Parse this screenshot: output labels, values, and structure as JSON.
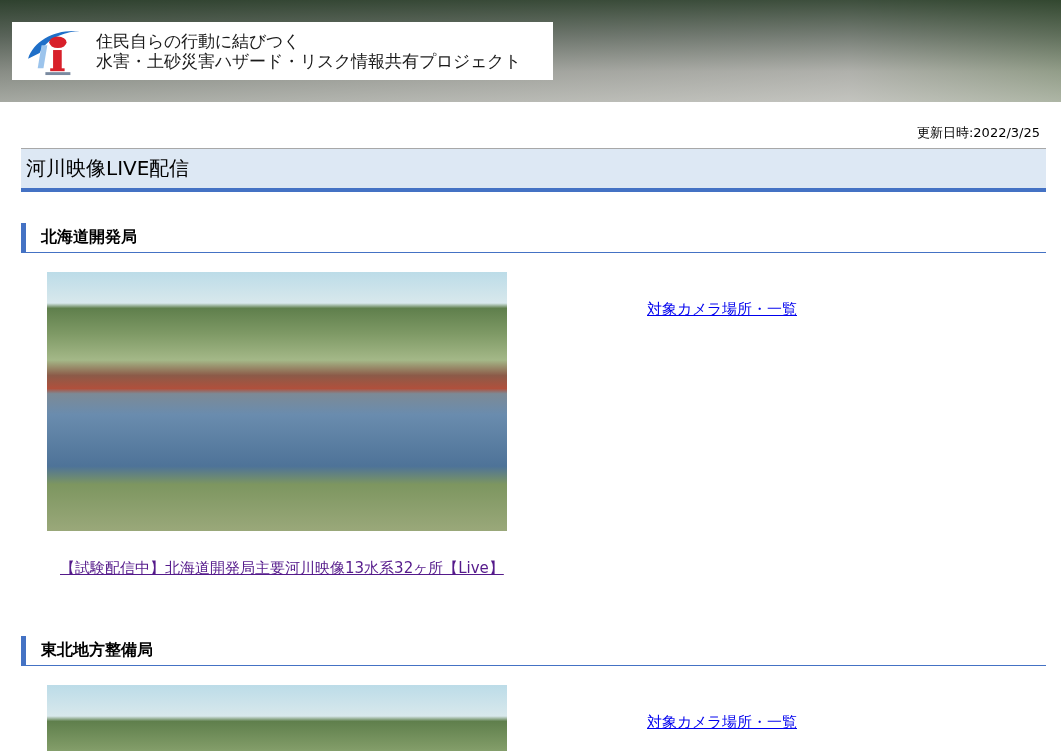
{
  "header": {
    "title_lines": [
      "住民自らの行動に結びつく",
      "水害・土砂災害ハザード・リスク情報共有プロジェクト"
    ]
  },
  "updated": "更新日時:2022/3/25",
  "page_title": "河川映像LIVE配信",
  "sections": [
    {
      "heading": "北海道開発局",
      "camera_list_link": {
        "label": "対象カメラ場所・一覧",
        "visited": false
      },
      "stream_link": {
        "label": "【試験配信中】北海道開発局主要河川映像13水系32ヶ所【Live】",
        "visited": true
      }
    },
    {
      "heading": "東北地方整備局",
      "camera_list_link": {
        "label": "対象カメラ場所・一覧",
        "visited": false
      }
    }
  ]
}
